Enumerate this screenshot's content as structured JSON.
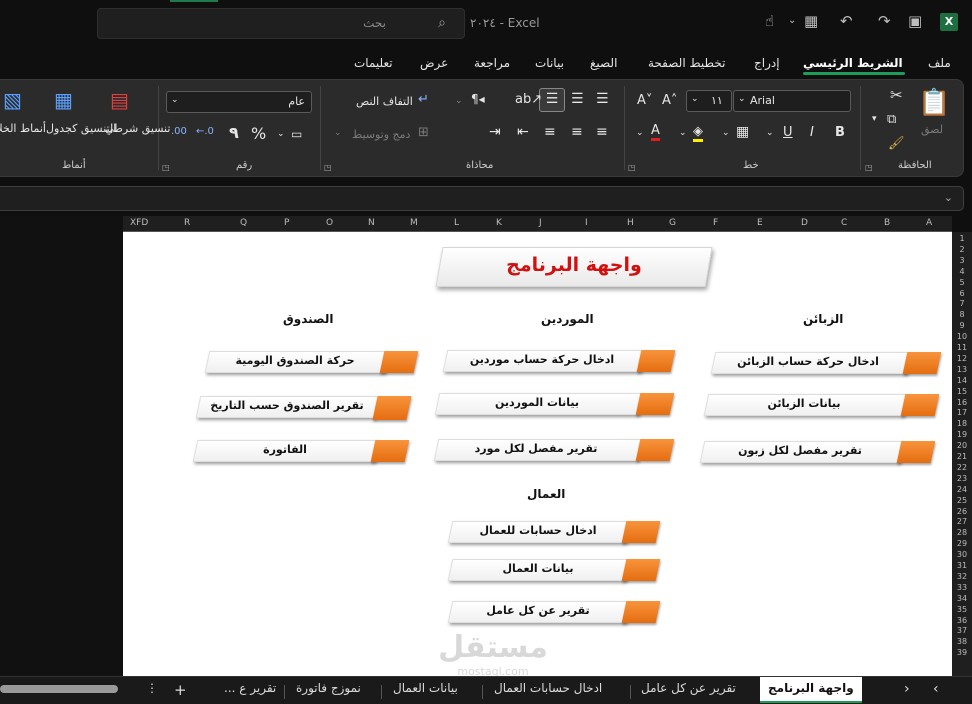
{
  "app": {
    "title": "Excel - ٢٠٢٤",
    "search_placeholder": "بحث"
  },
  "menu": {
    "items": [
      "ملف",
      "الشريط الرئيسي",
      "إدراج",
      "تخطيط الصفحة",
      "الصيغ",
      "بيانات",
      "مراجعة",
      "عرض",
      "تعليمات"
    ],
    "active": "الشريط الرئيسي"
  },
  "ribbon": {
    "clipboard": {
      "label": "الحافظة",
      "paste": "لصق"
    },
    "font": {
      "label": "خط",
      "name": "Arial",
      "size": "١١",
      "bold": "B",
      "italic": "I",
      "underline": "U"
    },
    "alignment": {
      "label": "محاذاة",
      "wrap": "التفاف النص",
      "merge": "دمج وتوسيط"
    },
    "number": {
      "label": "رقم",
      "format": "عام",
      "percent": "%",
      "comma": "٩"
    },
    "styles": {
      "label": "أنماط",
      "conditional": "تنسيق شرطي",
      "as_table": "التنسيق كجدول",
      "cell_styles": "أنماط الخلايا"
    }
  },
  "grid": {
    "columns": [
      "A",
      "B",
      "C",
      "D",
      "E",
      "F",
      "G",
      "H",
      "I",
      "J",
      "K",
      "L",
      "M",
      "N",
      "O",
      "P",
      "Q",
      "R",
      "XFD"
    ],
    "rows": [
      "1",
      "2",
      "3",
      "4",
      "5",
      "6",
      "7",
      "8",
      "9",
      "10",
      "11",
      "12",
      "13",
      "14",
      "15",
      "16",
      "17",
      "18",
      "19",
      "20",
      "21",
      "22",
      "23",
      "24",
      "25",
      "26",
      "27",
      "28",
      "29",
      "30",
      "31",
      "32",
      "33",
      "34",
      "35",
      "36",
      "37",
      "38",
      "39"
    ]
  },
  "dashboard": {
    "title": "واجهة البرنامج",
    "sections": {
      "customers": {
        "heading": "الزبائن",
        "buttons": [
          "ادخال حركة حساب الزبائن",
          "بيانات الزبائن",
          "تقرير مفصل لكل زبون"
        ]
      },
      "suppliers": {
        "heading": "الموردين",
        "buttons": [
          "ادخال حركة حساب موردين",
          "بيانات الموردين",
          "تقرير مفصل لكل مورد"
        ]
      },
      "cashbox": {
        "heading": "الصندوق",
        "buttons": [
          "حركة الصندوق اليومية",
          "تقرير الصندوق حسب التاريخ",
          "الفاتورة"
        ]
      },
      "workers": {
        "heading": "العمال",
        "buttons": [
          "ادخال حسابات للعمال",
          "بيانات العمال",
          "تقرير عن كل عامل"
        ]
      }
    }
  },
  "watermark": {
    "main": "مستقل",
    "sub": "mostaql.com"
  },
  "sheet_tabs": [
    "واجهة البرنامج",
    "تقرير عن كل عامل",
    "ادخال حسابات العمال",
    "بيانات العمال",
    "نموزج فاتورة",
    "تقرير ع ..."
  ],
  "active_tab": "واجهة البرنامج"
}
